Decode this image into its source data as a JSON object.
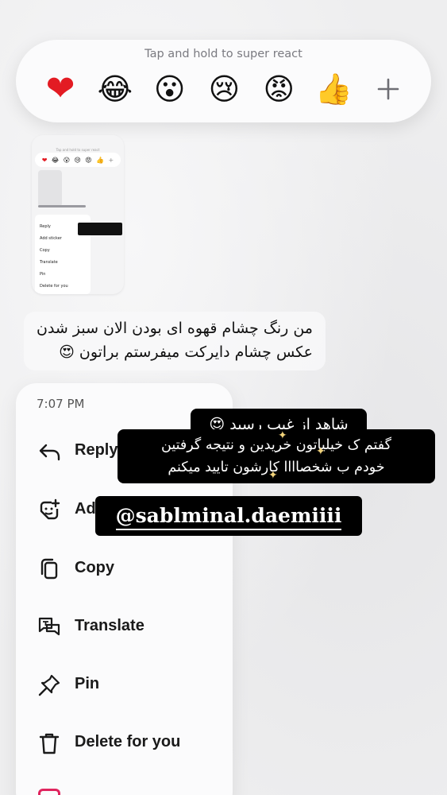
{
  "reaction_bar": {
    "hint": "Tap and hold to super react",
    "emojis": [
      "❤",
      "😂",
      "😮",
      "😢",
      "😡",
      "👍"
    ],
    "more": "+"
  },
  "thumbnail": {
    "hint": "Tap and hold to super react",
    "emojis": [
      "❤",
      "😂",
      "😮",
      "😢",
      "😡",
      "👍",
      "+"
    ],
    "menu_items": [
      "Reply",
      "Add sticker",
      "Copy",
      "Translate",
      "Pin",
      "Delete for you"
    ]
  },
  "message": {
    "line1": "من رنگ چشام قهوه ای بودن الان سبز شدن",
    "line2": "عکس چشام دایرکت میفرستم براتون 😍"
  },
  "context_menu": {
    "time": "7:07 PM",
    "items": [
      {
        "label": "Reply",
        "icon": "reply-icon"
      },
      {
        "label": "Ad",
        "icon": "add-sticker-icon"
      },
      {
        "label": "Copy",
        "icon": "copy-icon"
      },
      {
        "label": "Translate",
        "icon": "translate-icon"
      },
      {
        "label": "Pin",
        "icon": "pin-icon"
      },
      {
        "label": "Delete for you",
        "icon": "trash-icon"
      }
    ]
  },
  "story_overlay": {
    "line1": "شاهد از غیب رسید 😍",
    "line2": "گفتم ک خیلیاتون خریدین و نتیجه گرفتین",
    "line3": "خودم ب شخصاااا کارشون تایید میکنم",
    "handle": "@sablminal.daemiiii"
  },
  "colors": {
    "background": "#eeeeef",
    "menu_bg": "#fbfbfc",
    "overlay_bg": "#000000",
    "danger": "#e0245e"
  }
}
